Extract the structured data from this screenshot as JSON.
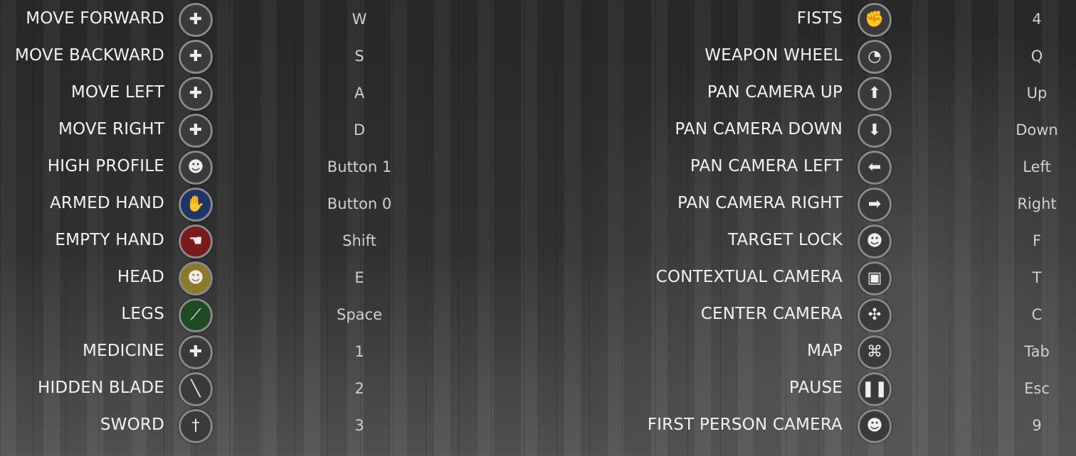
{
  "left_column": [
    {
      "action": "MOVE FORWARD",
      "icon": "dpad-icon",
      "glyph": "✚",
      "color": "#3a3a3a",
      "key": "W"
    },
    {
      "action": "MOVE BACKWARD",
      "icon": "dpad-icon",
      "glyph": "✚",
      "color": "#3a3a3a",
      "key": "S"
    },
    {
      "action": "MOVE LEFT",
      "icon": "dpad-icon",
      "glyph": "✚",
      "color": "#3a3a3a",
      "key": "A"
    },
    {
      "action": "MOVE RIGHT",
      "icon": "dpad-icon",
      "glyph": "✚",
      "color": "#3a3a3a",
      "key": "D"
    },
    {
      "action": "HIGH PROFILE",
      "icon": "head-arrow-up-icon",
      "glyph": "☻",
      "color": "#3a3a3a",
      "key": "Button 1"
    },
    {
      "action": "ARMED HAND",
      "icon": "armed-hand-icon",
      "glyph": "✋",
      "color": "#1e3566",
      "key": "Button 0"
    },
    {
      "action": "EMPTY HAND",
      "icon": "empty-hand-icon",
      "glyph": "☚",
      "color": "#7a1b1b",
      "key": "Shift"
    },
    {
      "action": "HEAD",
      "icon": "head-icon",
      "glyph": "☻",
      "color": "#8a7a2a",
      "key": "E"
    },
    {
      "action": "LEGS",
      "icon": "leg-icon",
      "glyph": "⟋",
      "color": "#1f4a24",
      "key": "Space"
    },
    {
      "action": "MEDICINE",
      "icon": "medicine-bottle-icon",
      "glyph": "✚",
      "color": "#3a3a3a",
      "key": "1"
    },
    {
      "action": "HIDDEN BLADE",
      "icon": "hidden-blade-icon",
      "glyph": "╲",
      "color": "#3a3a3a",
      "key": "2"
    },
    {
      "action": "SWORD",
      "icon": "sword-icon",
      "glyph": "†",
      "color": "#3a3a3a",
      "key": "3"
    }
  ],
  "right_column": [
    {
      "action": "FISTS",
      "icon": "fist-icon",
      "glyph": "✊",
      "color": "#3a3a3a",
      "key": "4"
    },
    {
      "action": "WEAPON WHEEL",
      "icon": "weapon-wheel-icon",
      "glyph": "◔",
      "color": "#3a3a3a",
      "key": "Q"
    },
    {
      "action": "PAN CAMERA UP",
      "icon": "arrow-up-icon",
      "glyph": "⬆",
      "color": "#3a3a3a",
      "key": "Up"
    },
    {
      "action": "PAN CAMERA DOWN",
      "icon": "arrow-down-icon",
      "glyph": "⬇",
      "color": "#3a3a3a",
      "key": "Down"
    },
    {
      "action": "PAN CAMERA LEFT",
      "icon": "arrow-left-icon",
      "glyph": "⬅",
      "color": "#3a3a3a",
      "key": "Left"
    },
    {
      "action": "PAN CAMERA RIGHT",
      "icon": "arrow-right-icon",
      "glyph": "➡",
      "color": "#3a3a3a",
      "key": "Right"
    },
    {
      "action": "TARGET LOCK",
      "icon": "head-lock-icon",
      "glyph": "☻",
      "color": "#3a3a3a",
      "key": "F"
    },
    {
      "action": "CONTEXTUAL CAMERA",
      "icon": "camera-icon",
      "glyph": "▣",
      "color": "#3a3a3a",
      "key": "T"
    },
    {
      "action": "CENTER CAMERA",
      "icon": "center-camera-icon",
      "glyph": "✣",
      "color": "#3a3a3a",
      "key": "C"
    },
    {
      "action": "MAP",
      "icon": "map-icon",
      "glyph": "⌘",
      "color": "#3a3a3a",
      "key": "Tab"
    },
    {
      "action": "PAUSE",
      "icon": "pause-icon",
      "glyph": "❚❚",
      "color": "#3a3a3a",
      "key": "Esc"
    },
    {
      "action": "FIRST PERSON CAMERA",
      "icon": "head-camera-icon",
      "glyph": "☻",
      "color": "#3a3a3a",
      "key": "9"
    }
  ]
}
